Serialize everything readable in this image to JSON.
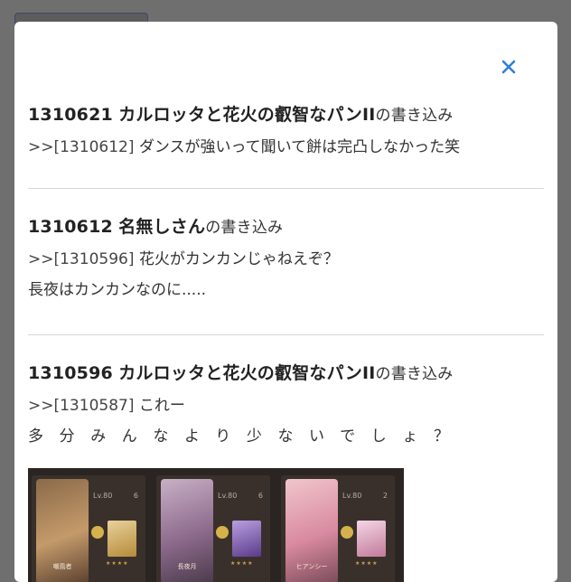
{
  "close_icon": "close-icon",
  "accent_color": "#2f7fd6",
  "posts": [
    {
      "id": "1310621",
      "name": "カルロッタと花火の叡智なパンII",
      "suffix": "の書き込み",
      "ref": ">>[1310612]",
      "lines": [
        "ダンスが強いって聞いて餅は完凸しなかった笑"
      ]
    },
    {
      "id": "1310612",
      "name": "名無しさん",
      "suffix": "の書き込み",
      "ref": ">>[1310596]",
      "lines": [
        "花火がカンカンじゃねえぞ？",
        "長夜はカンカンなのに....."
      ]
    },
    {
      "id": "1310596",
      "name": "カルロッタと花火の叡智なパンII",
      "suffix": "の書き込み",
      "ref": ">>[1310587]",
      "lines": [
        "これー",
        "多分みんなより少ないでしょ？"
      ]
    }
  ],
  "game_cards": [
    {
      "char_name": "嘲風者",
      "lv": "Lv.80",
      "count": "6",
      "stars": "★★★★"
    },
    {
      "char_name": "長夜月",
      "lv": "Lv.80",
      "count": "6",
      "stars": "★★★★"
    },
    {
      "char_name": "ヒアンシー",
      "lv": "Lv.80",
      "count": "2",
      "stars": "★★★★"
    }
  ]
}
